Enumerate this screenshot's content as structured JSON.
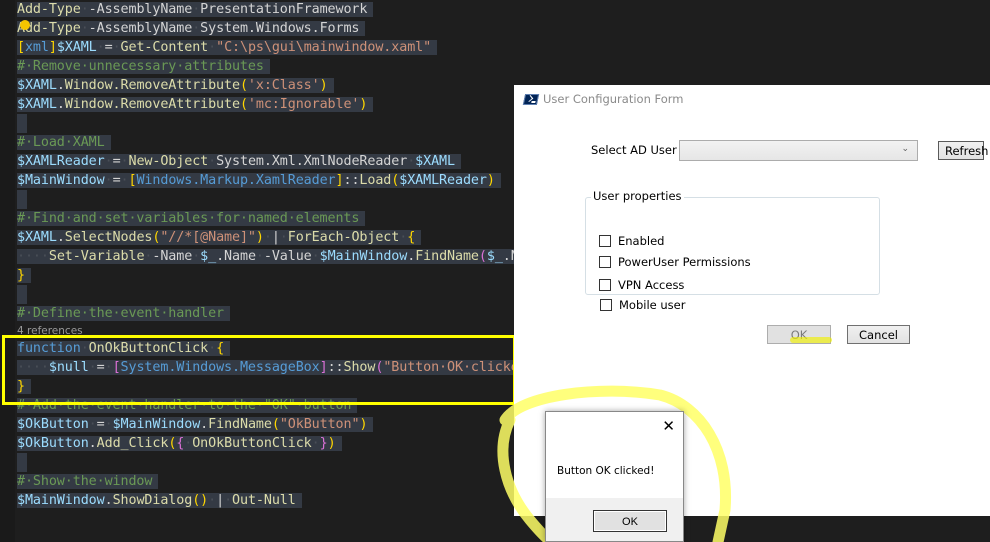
{
  "editor": {
    "lines": [
      {
        "text": "Add-Type -AssemblyName PresentationFramework"
      },
      {
        "text": "Add-Type -AssemblyName System.Windows.Forms"
      },
      {
        "text": "[xml]$XAML = Get-Content \"C:\\ps\\gui\\mainwindow.xaml\""
      },
      {
        "text": "# Remove unnecessary attributes"
      },
      {
        "text": "$XAML.Window.RemoveAttribute('x:Class')"
      },
      {
        "text": "$XAML.Window.RemoveAttribute('mc:Ignorable')"
      },
      {
        "text": ""
      },
      {
        "text": "# Load XAML"
      },
      {
        "text": "$XAMLReader = New-Object System.Xml.XmlNodeReader $XAML"
      },
      {
        "text": "$MainWindow = [Windows.Markup.XamlReader]::Load($XAMLReader)"
      },
      {
        "text": ""
      },
      {
        "text": "# Find and set variables for named elements"
      },
      {
        "text": "$XAML.SelectNodes(\"//*[@Name]\") | ForEach-Object {"
      },
      {
        "text": "    Set-Variable -Name $_.Name -Value $MainWindow.FindName($_.Name)"
      },
      {
        "text": "}"
      },
      {
        "text": ""
      },
      {
        "text": "# Define the event handler"
      },
      {
        "text": "function OnOkButtonClick {"
      },
      {
        "text": "    $null = [System.Windows.MessageBox]::Show(\"Button OK clicked!\")"
      },
      {
        "text": "}"
      },
      {
        "text": "# Add the event handler to the \"OK\" button"
      },
      {
        "text": "$OkButton = $MainWindow.FindName(\"OkButton\")"
      },
      {
        "text": "$OkButton.Add_Click({ OnOkButtonClick })"
      },
      {
        "text": ""
      },
      {
        "text": "# Show the window"
      },
      {
        "text": "$MainWindow.ShowDialog() | Out-Null"
      }
    ],
    "codelens": "4 references"
  },
  "main_window": {
    "title": "User Configuration Form",
    "select_label": "Select AD User",
    "combo_value": "",
    "combo_chevron": "⌄",
    "refresh_label": "Refresh",
    "group_title": "User properties",
    "checkboxes": [
      {
        "label": "Enabled",
        "checked": false
      },
      {
        "label": "PowerUser Permissions",
        "checked": false
      },
      {
        "label": "VPN Access",
        "checked": false
      },
      {
        "label": "Mobile user",
        "checked": false
      }
    ],
    "ok_label": "OK",
    "cancel_label": "Cancel"
  },
  "message_box": {
    "message": "Button OK clicked!",
    "ok_label": "OK",
    "close_glyph": "✕"
  },
  "annotations": {
    "highlight_color": "#ffff00",
    "circle_color": "#ffff66"
  }
}
